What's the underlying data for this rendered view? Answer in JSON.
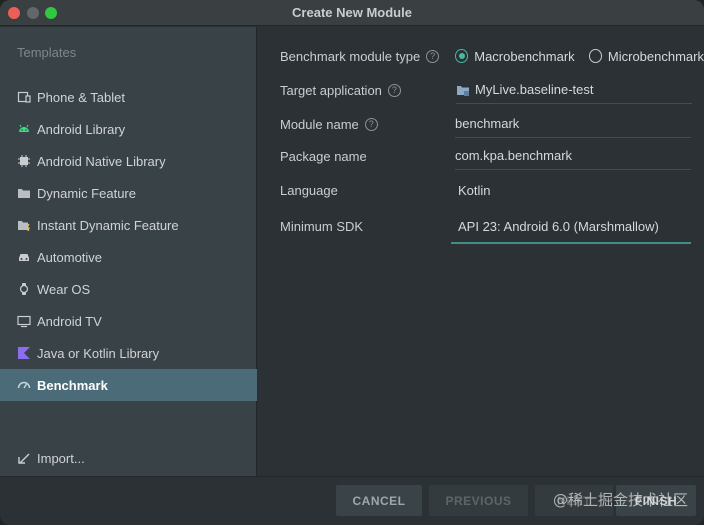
{
  "window": {
    "title": "Create New Module"
  },
  "sidebar": {
    "header": "Templates",
    "items": [
      {
        "label": "Phone & Tablet",
        "icon": "phone-tablet-icon"
      },
      {
        "label": "Android Library",
        "icon": "android-icon"
      },
      {
        "label": "Android Native Library",
        "icon": "native-library-icon"
      },
      {
        "label": "Dynamic Feature",
        "icon": "folder-icon"
      },
      {
        "label": "Instant Dynamic Feature",
        "icon": "folder-lightning-icon"
      },
      {
        "label": "Automotive",
        "icon": "car-icon"
      },
      {
        "label": "Wear OS",
        "icon": "watch-icon"
      },
      {
        "label": "Android TV",
        "icon": "tv-icon"
      },
      {
        "label": "Java or Kotlin Library",
        "icon": "kotlin-icon"
      },
      {
        "label": "Benchmark",
        "icon": "gauge-icon",
        "selected": true
      }
    ],
    "import_label": "Import..."
  },
  "form": {
    "benchmark_type": {
      "label": "Benchmark module type",
      "options": [
        "Macrobenchmark",
        "Microbenchmark"
      ],
      "selected": "Macrobenchmark"
    },
    "target_application": {
      "label": "Target application",
      "value": "MyLive.baseline-test"
    },
    "module_name": {
      "label": "Module name",
      "value": "benchmark"
    },
    "package_name": {
      "label": "Package name",
      "value": "com.kpa.benchmark"
    },
    "language": {
      "label": "Language",
      "value": "Kotlin"
    },
    "minimum_sdk": {
      "label": "Minimum SDK",
      "value": "API 23: Android 6.0 (Marshmallow)"
    }
  },
  "footer": {
    "cancel": "CANCEL",
    "previous": "PREVIOUS",
    "next": "NEXT",
    "finish": "FINISH"
  },
  "watermark": "@稀土掘金技术社区",
  "colors": {
    "accent": "#49b6a6",
    "selection": "#4b6b78",
    "background": "#2b3134",
    "sidebar": "#394246"
  }
}
